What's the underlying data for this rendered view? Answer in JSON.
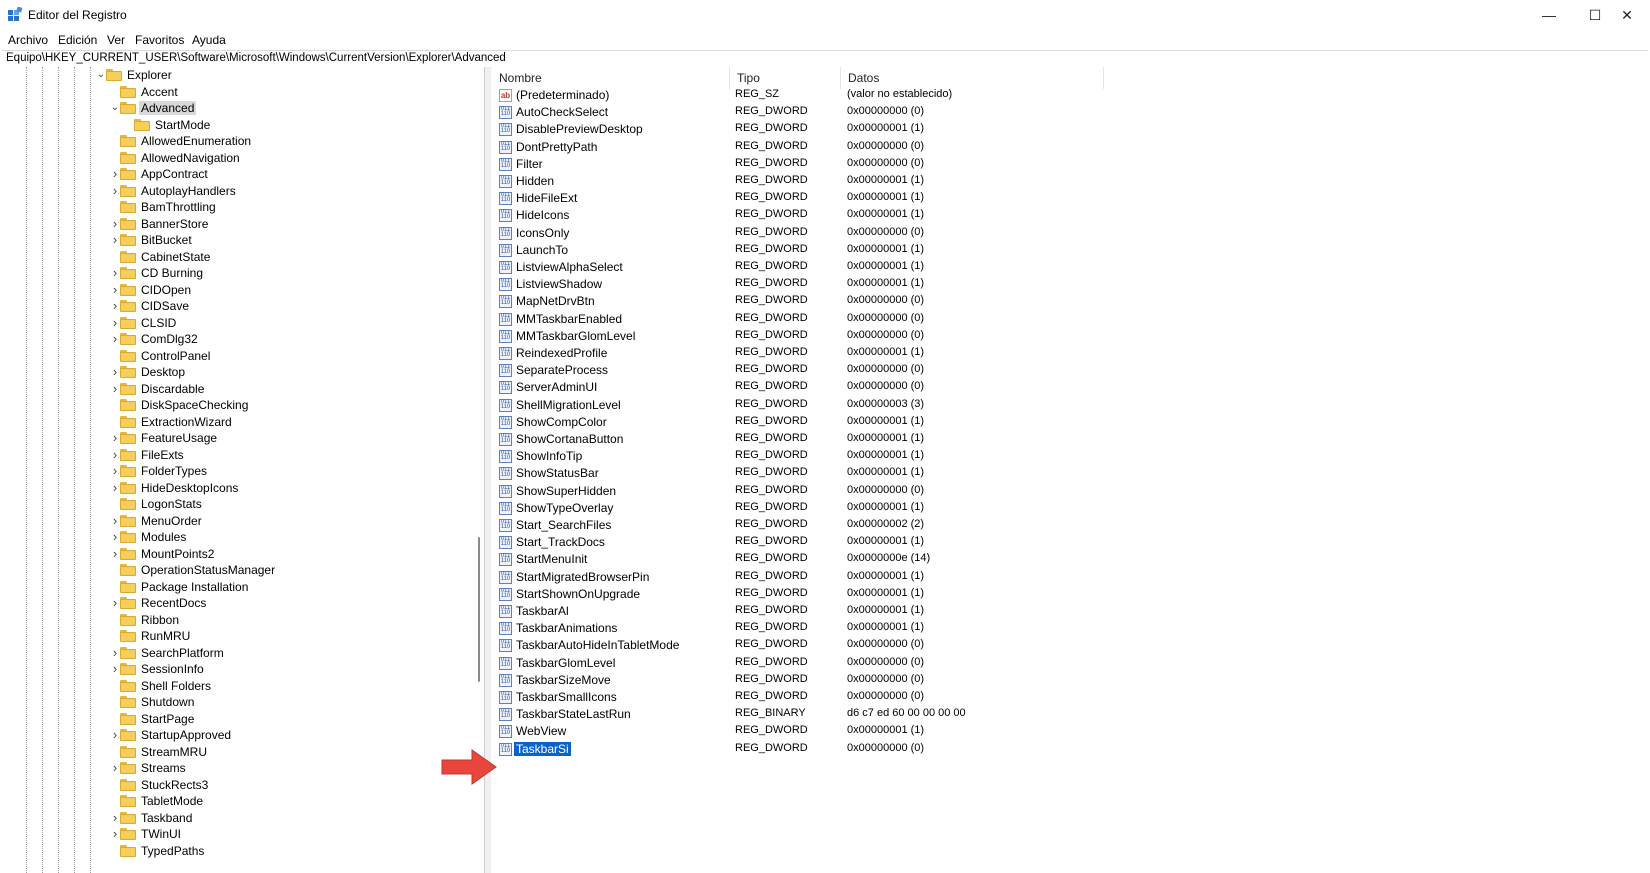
{
  "window": {
    "title": "Editor del Registro",
    "minimize": "—",
    "maximize": "☐",
    "close": "✕"
  },
  "menu": [
    "Archivo",
    "Edición",
    "Ver",
    "Favoritos",
    "Ayuda"
  ],
  "address": "Equipo\\HKEY_CURRENT_USER\\Software\\Microsoft\\Windows\\CurrentVersion\\Explorer\\Advanced",
  "tree": [
    {
      "label": "Explorer",
      "level": 0,
      "chevron": "expanded"
    },
    {
      "label": "Accent",
      "level": 1,
      "chevron": "none"
    },
    {
      "label": "Advanced",
      "level": 1,
      "chevron": "expanded",
      "selected": true
    },
    {
      "label": "StartMode",
      "level": 2,
      "chevron": "none"
    },
    {
      "label": "AllowedEnumeration",
      "level": 1,
      "chevron": "none"
    },
    {
      "label": "AllowedNavigation",
      "level": 1,
      "chevron": "none"
    },
    {
      "label": "AppContract",
      "level": 1,
      "chevron": "collapsed"
    },
    {
      "label": "AutoplayHandlers",
      "level": 1,
      "chevron": "collapsed"
    },
    {
      "label": "BamThrottling",
      "level": 1,
      "chevron": "none"
    },
    {
      "label": "BannerStore",
      "level": 1,
      "chevron": "collapsed"
    },
    {
      "label": "BitBucket",
      "level": 1,
      "chevron": "collapsed"
    },
    {
      "label": "CabinetState",
      "level": 1,
      "chevron": "none"
    },
    {
      "label": "CD Burning",
      "level": 1,
      "chevron": "collapsed"
    },
    {
      "label": "CIDOpen",
      "level": 1,
      "chevron": "collapsed"
    },
    {
      "label": "CIDSave",
      "level": 1,
      "chevron": "collapsed"
    },
    {
      "label": "CLSID",
      "level": 1,
      "chevron": "collapsed"
    },
    {
      "label": "ComDlg32",
      "level": 1,
      "chevron": "collapsed"
    },
    {
      "label": "ControlPanel",
      "level": 1,
      "chevron": "none"
    },
    {
      "label": "Desktop",
      "level": 1,
      "chevron": "collapsed"
    },
    {
      "label": "Discardable",
      "level": 1,
      "chevron": "collapsed"
    },
    {
      "label": "DiskSpaceChecking",
      "level": 1,
      "chevron": "none"
    },
    {
      "label": "ExtractionWizard",
      "level": 1,
      "chevron": "none"
    },
    {
      "label": "FeatureUsage",
      "level": 1,
      "chevron": "collapsed"
    },
    {
      "label": "FileExts",
      "level": 1,
      "chevron": "collapsed"
    },
    {
      "label": "FolderTypes",
      "level": 1,
      "chevron": "collapsed"
    },
    {
      "label": "HideDesktopIcons",
      "level": 1,
      "chevron": "collapsed"
    },
    {
      "label": "LogonStats",
      "level": 1,
      "chevron": "none"
    },
    {
      "label": "MenuOrder",
      "level": 1,
      "chevron": "collapsed"
    },
    {
      "label": "Modules",
      "level": 1,
      "chevron": "collapsed"
    },
    {
      "label": "MountPoints2",
      "level": 1,
      "chevron": "collapsed"
    },
    {
      "label": "OperationStatusManager",
      "level": 1,
      "chevron": "none"
    },
    {
      "label": "Package Installation",
      "level": 1,
      "chevron": "none"
    },
    {
      "label": "RecentDocs",
      "level": 1,
      "chevron": "collapsed"
    },
    {
      "label": "Ribbon",
      "level": 1,
      "chevron": "none"
    },
    {
      "label": "RunMRU",
      "level": 1,
      "chevron": "none"
    },
    {
      "label": "SearchPlatform",
      "level": 1,
      "chevron": "collapsed"
    },
    {
      "label": "SessionInfo",
      "level": 1,
      "chevron": "collapsed"
    },
    {
      "label": "Shell Folders",
      "level": 1,
      "chevron": "none"
    },
    {
      "label": "Shutdown",
      "level": 1,
      "chevron": "none"
    },
    {
      "label": "StartPage",
      "level": 1,
      "chevron": "none"
    },
    {
      "label": "StartupApproved",
      "level": 1,
      "chevron": "collapsed"
    },
    {
      "label": "StreamMRU",
      "level": 1,
      "chevron": "none"
    },
    {
      "label": "Streams",
      "level": 1,
      "chevron": "collapsed"
    },
    {
      "label": "StuckRects3",
      "level": 1,
      "chevron": "none"
    },
    {
      "label": "TabletMode",
      "level": 1,
      "chevron": "none"
    },
    {
      "label": "Taskband",
      "level": 1,
      "chevron": "collapsed"
    },
    {
      "label": "TWinUI",
      "level": 1,
      "chevron": "collapsed"
    },
    {
      "label": "TypedPaths",
      "level": 1,
      "chevron": "none"
    }
  ],
  "columns": {
    "name": "Nombre",
    "type": "Tipo",
    "data": "Datos"
  },
  "values": [
    {
      "name": "(Predeterminado)",
      "type": "REG_SZ",
      "data": "(valor no establecido)",
      "icon": "string-value-icon"
    },
    {
      "name": "AutoCheckSelect",
      "type": "REG_DWORD",
      "data": "0x00000000 (0)",
      "icon": "dword-value-icon"
    },
    {
      "name": "DisablePreviewDesktop",
      "type": "REG_DWORD",
      "data": "0x00000001 (1)",
      "icon": "dword-value-icon"
    },
    {
      "name": "DontPrettyPath",
      "type": "REG_DWORD",
      "data": "0x00000000 (0)",
      "icon": "dword-value-icon"
    },
    {
      "name": "Filter",
      "type": "REG_DWORD",
      "data": "0x00000000 (0)",
      "icon": "dword-value-icon"
    },
    {
      "name": "Hidden",
      "type": "REG_DWORD",
      "data": "0x00000001 (1)",
      "icon": "dword-value-icon"
    },
    {
      "name": "HideFileExt",
      "type": "REG_DWORD",
      "data": "0x00000001 (1)",
      "icon": "dword-value-icon"
    },
    {
      "name": "HideIcons",
      "type": "REG_DWORD",
      "data": "0x00000001 (1)",
      "icon": "dword-value-icon"
    },
    {
      "name": "IconsOnly",
      "type": "REG_DWORD",
      "data": "0x00000000 (0)",
      "icon": "dword-value-icon"
    },
    {
      "name": "LaunchTo",
      "type": "REG_DWORD",
      "data": "0x00000001 (1)",
      "icon": "dword-value-icon"
    },
    {
      "name": "ListviewAlphaSelect",
      "type": "REG_DWORD",
      "data": "0x00000001 (1)",
      "icon": "dword-value-icon"
    },
    {
      "name": "ListviewShadow",
      "type": "REG_DWORD",
      "data": "0x00000001 (1)",
      "icon": "dword-value-icon"
    },
    {
      "name": "MapNetDrvBtn",
      "type": "REG_DWORD",
      "data": "0x00000000 (0)",
      "icon": "dword-value-icon"
    },
    {
      "name": "MMTaskbarEnabled",
      "type": "REG_DWORD",
      "data": "0x00000000 (0)",
      "icon": "dword-value-icon"
    },
    {
      "name": "MMTaskbarGlomLevel",
      "type": "REG_DWORD",
      "data": "0x00000000 (0)",
      "icon": "dword-value-icon"
    },
    {
      "name": "ReindexedProfile",
      "type": "REG_DWORD",
      "data": "0x00000001 (1)",
      "icon": "dword-value-icon"
    },
    {
      "name": "SeparateProcess",
      "type": "REG_DWORD",
      "data": "0x00000000 (0)",
      "icon": "dword-value-icon"
    },
    {
      "name": "ServerAdminUI",
      "type": "REG_DWORD",
      "data": "0x00000000 (0)",
      "icon": "dword-value-icon"
    },
    {
      "name": "ShellMigrationLevel",
      "type": "REG_DWORD",
      "data": "0x00000003 (3)",
      "icon": "dword-value-icon"
    },
    {
      "name": "ShowCompColor",
      "type": "REG_DWORD",
      "data": "0x00000001 (1)",
      "icon": "dword-value-icon"
    },
    {
      "name": "ShowCortanaButton",
      "type": "REG_DWORD",
      "data": "0x00000001 (1)",
      "icon": "dword-value-icon"
    },
    {
      "name": "ShowInfoTip",
      "type": "REG_DWORD",
      "data": "0x00000001 (1)",
      "icon": "dword-value-icon"
    },
    {
      "name": "ShowStatusBar",
      "type": "REG_DWORD",
      "data": "0x00000001 (1)",
      "icon": "dword-value-icon"
    },
    {
      "name": "ShowSuperHidden",
      "type": "REG_DWORD",
      "data": "0x00000000 (0)",
      "icon": "dword-value-icon"
    },
    {
      "name": "ShowTypeOverlay",
      "type": "REG_DWORD",
      "data": "0x00000001 (1)",
      "icon": "dword-value-icon"
    },
    {
      "name": "Start_SearchFiles",
      "type": "REG_DWORD",
      "data": "0x00000002 (2)",
      "icon": "dword-value-icon"
    },
    {
      "name": "Start_TrackDocs",
      "type": "REG_DWORD",
      "data": "0x00000001 (1)",
      "icon": "dword-value-icon"
    },
    {
      "name": "StartMenuInit",
      "type": "REG_DWORD",
      "data": "0x0000000e (14)",
      "icon": "dword-value-icon"
    },
    {
      "name": "StartMigratedBrowserPin",
      "type": "REG_DWORD",
      "data": "0x00000001 (1)",
      "icon": "dword-value-icon"
    },
    {
      "name": "StartShownOnUpgrade",
      "type": "REG_DWORD",
      "data": "0x00000001 (1)",
      "icon": "dword-value-icon"
    },
    {
      "name": "TaskbarAl",
      "type": "REG_DWORD",
      "data": "0x00000001 (1)",
      "icon": "dword-value-icon"
    },
    {
      "name": "TaskbarAnimations",
      "type": "REG_DWORD",
      "data": "0x00000001 (1)",
      "icon": "dword-value-icon"
    },
    {
      "name": "TaskbarAutoHideInTabletMode",
      "type": "REG_DWORD",
      "data": "0x00000000 (0)",
      "icon": "dword-value-icon"
    },
    {
      "name": "TaskbarGlomLevel",
      "type": "REG_DWORD",
      "data": "0x00000000 (0)",
      "icon": "dword-value-icon"
    },
    {
      "name": "TaskbarSizeMove",
      "type": "REG_DWORD",
      "data": "0x00000000 (0)",
      "icon": "dword-value-icon"
    },
    {
      "name": "TaskbarSmallIcons",
      "type": "REG_DWORD",
      "data": "0x00000000 (0)",
      "icon": "dword-value-icon"
    },
    {
      "name": "TaskbarStateLastRun",
      "type": "REG_BINARY",
      "data": "d6 c7 ed 60 00 00 00 00",
      "icon": "binary-value-icon"
    },
    {
      "name": "WebView",
      "type": "REG_DWORD",
      "data": "0x00000001 (1)",
      "icon": "dword-value-icon"
    },
    {
      "name": "TaskbarSi",
      "type": "REG_DWORD",
      "data": "0x00000000 (0)",
      "icon": "dword-value-icon",
      "selected": true
    }
  ],
  "colors": {
    "selection": "#0a64c8",
    "arrow": "#e8453c",
    "folder": "#f6cf5a"
  }
}
